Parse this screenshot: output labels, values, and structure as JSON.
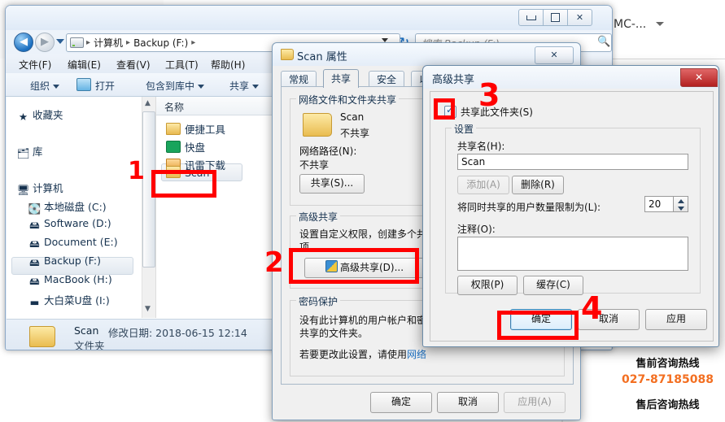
{
  "background": {
    "account_label": "MC-...",
    "presales_label": "售前咨询热线",
    "presales_number": "027-87185088",
    "aftersales_label": "售后咨询热线"
  },
  "explorer": {
    "nav": {
      "back_glyph": "◀",
      "forward_glyph": "▶",
      "refresh_glyph": "↻"
    },
    "breadcrumbs": [
      "计算机",
      "Backup (F:)"
    ],
    "search": {
      "placeholder": "搜索 Backup (F:)",
      "icon": "search-icon"
    },
    "menus": [
      "文件(F)",
      "编辑(E)",
      "查看(V)",
      "工具(T)",
      "帮助(H)"
    ],
    "toolbar": [
      "组织",
      "打开",
      "包含到库中",
      "共享"
    ],
    "nav_pane": [
      {
        "label": "收藏夹",
        "icon": "star-icon",
        "selected": false
      },
      {
        "label": "库",
        "icon": "library-icon",
        "selected": false
      },
      {
        "label": "计算机",
        "icon": "computer-icon",
        "selected": false
      },
      {
        "label": "本地磁盘 (C:)",
        "icon": "system-drive-icon",
        "selected": false
      },
      {
        "label": "Software (D:)",
        "icon": "drive-icon",
        "selected": false
      },
      {
        "label": "Document (E:)",
        "icon": "drive-icon",
        "selected": false
      },
      {
        "label": "Backup (F:)",
        "icon": "drive-icon",
        "selected": true
      },
      {
        "label": "MacBook (H:)",
        "icon": "drive-icon",
        "selected": false
      },
      {
        "label": "大白菜U盘 (I:)",
        "icon": "usb-drive-icon",
        "selected": false
      }
    ],
    "list_header": "名称",
    "files": [
      {
        "name": "便捷工具",
        "icon": "folder-icon",
        "selected": false
      },
      {
        "name": "快盘",
        "icon": "kuaipan-icon",
        "selected": false
      },
      {
        "name": "讯雷下载",
        "icon": "thunder-icon",
        "selected": false
      },
      {
        "name": "Scan",
        "icon": "folder-icon",
        "selected": true
      }
    ],
    "details": {
      "name": "Scan",
      "modified": "修改日期: 2018-06-15 12:14",
      "type": "文件夹"
    }
  },
  "properties_dialog": {
    "title": "Scan 属性",
    "close_glyph": "✕",
    "tabs": [
      {
        "label": "常规",
        "active": false
      },
      {
        "label": "共享",
        "active": true
      },
      {
        "label": "安全",
        "active": false
      },
      {
        "label": "以前",
        "active": false
      }
    ],
    "network_group": {
      "legend": "网络文件和文件夹共享",
      "folder_name": "Scan",
      "folder_state": "不共享",
      "path_label": "网络路径(N):",
      "path_value": "不共享",
      "share_button": "共享(S)..."
    },
    "advanced_group": {
      "legend": "高级共享",
      "description_line1": "设置自定义权限，创建多个共",
      "description_line2": "项。",
      "button": "高级共享(D)..."
    },
    "password_group": {
      "legend": "密码保护",
      "line1": "没有此计算机的用户帐户和密",
      "line2": "共享的文件夹。",
      "line3": "若要更改此设置，请使用",
      "link": "网络"
    },
    "buttons": {
      "ok": "确定",
      "cancel": "取消",
      "apply": "应用(A)"
    }
  },
  "advanced_dialog": {
    "title": "高级共享",
    "close_glyph": "✕",
    "share_checkbox": {
      "label": "共享此文件夹(S)",
      "checked": true
    },
    "settings_group": {
      "legend": "设置",
      "share_name_label": "共享名(H):",
      "share_name_value": "Scan",
      "add_button": "添加(A)",
      "remove_button": "删除(R)",
      "user_limit_label": "将同时共享的用户数量限制为(L):",
      "user_limit_value": "20",
      "comment_label": "注释(O):",
      "comment_value": "",
      "permissions_button": "权限(P)",
      "cache_button": "缓存(C)"
    },
    "buttons": {
      "ok": "确定",
      "cancel": "取消",
      "apply": "应用"
    }
  },
  "annotations": [
    {
      "id": "1",
      "target": "scan-folder-in-list"
    },
    {
      "id": "2",
      "target": "advanced-share-button"
    },
    {
      "id": "3",
      "target": "share-this-folder-checkbox"
    },
    {
      "id": "4",
      "target": "advanced-dialog-ok-button"
    }
  ]
}
